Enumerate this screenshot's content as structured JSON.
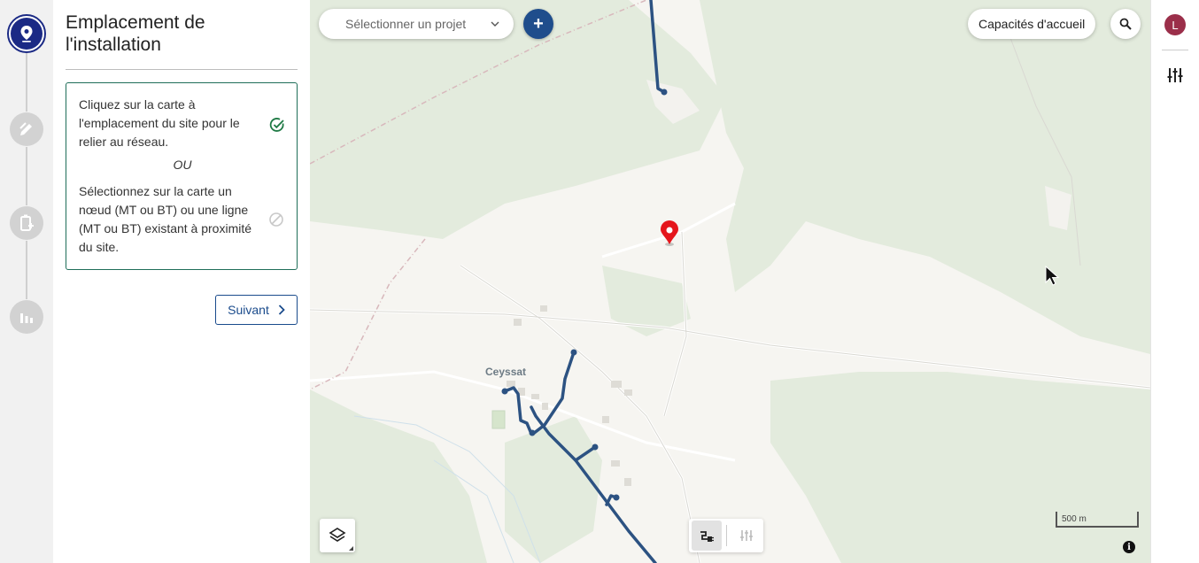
{
  "stepper": {
    "steps": [
      {
        "icon": "location-pin-icon",
        "active": true
      },
      {
        "icon": "edit-icon",
        "active": false
      },
      {
        "icon": "battery-plug-icon",
        "active": false
      },
      {
        "icon": "bar-chart-icon",
        "active": false
      }
    ]
  },
  "panel": {
    "title": "Emplacement de l'installation",
    "option_1": "Cliquez sur la carte à l'emplacement du site pour le relier au réseau.",
    "separator_word": "OU",
    "option_2": "Sélectionnez sur la carte un nœud (MT ou BT) ou une ligne (MT ou BT) existant à proximité du site.",
    "next_label": "Suivant"
  },
  "map": {
    "project_select_placeholder": "Sélectionner un projet",
    "add_label": "+",
    "capacity_label": "Capacités d'accueil",
    "town_label": "Ceyssat",
    "scale_label": "500 m",
    "info_label": "i",
    "colors": {
      "network_line": "#2c5282",
      "marker": "#e5161c",
      "forest": "#e3ebdd",
      "background": "#f6f5f1"
    }
  },
  "rightbar": {
    "avatar_letter": "L"
  }
}
